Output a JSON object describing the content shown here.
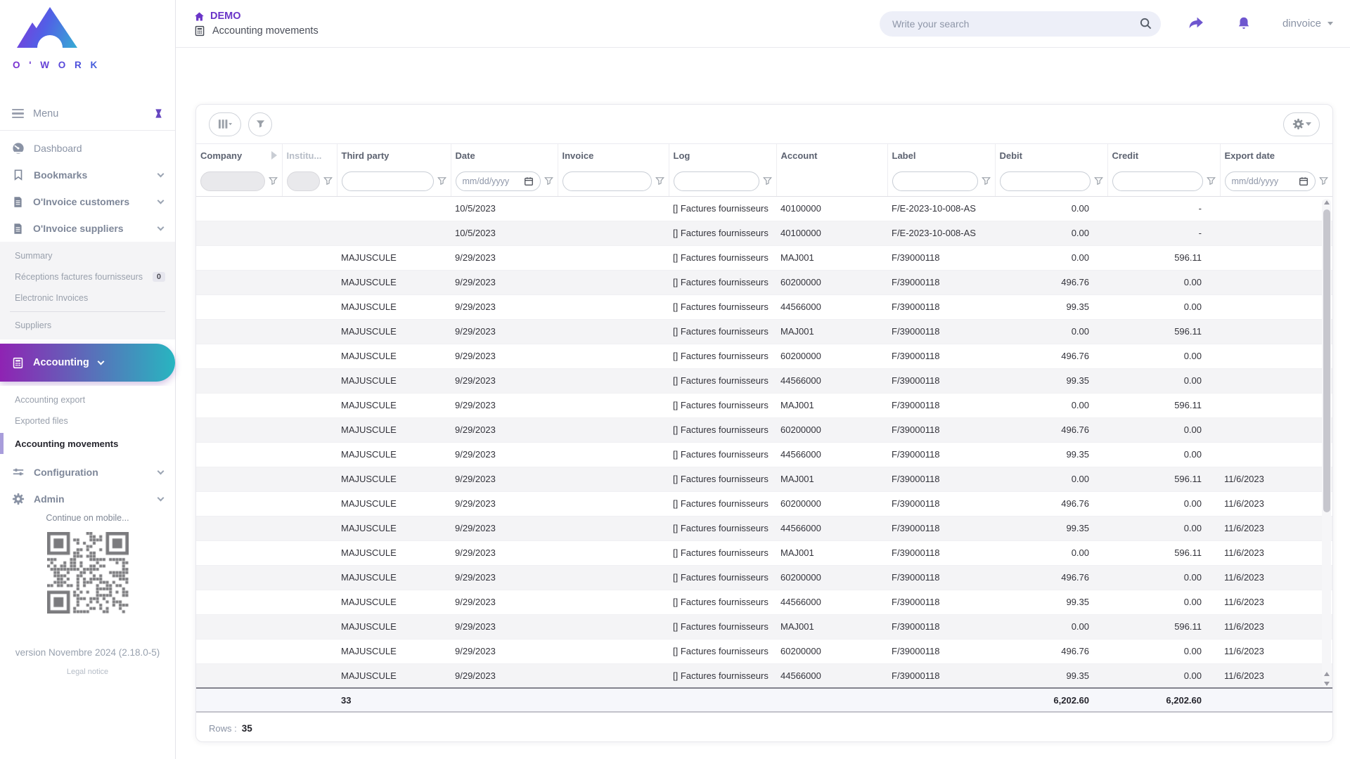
{
  "brand": {
    "wordmark": "O ' W O R K"
  },
  "header": {
    "site_label": "DEMO",
    "breadcrumb": "Accounting movements",
    "search_placeholder": "Write your search",
    "username": "dinvoice"
  },
  "sidebar": {
    "menu_label": "Menu",
    "items": {
      "dashboard": "Dashboard",
      "bookmarks": "Bookmarks",
      "customers": "O'Invoice customers",
      "suppliers_group": "O'Invoice suppliers",
      "accounting": "Accounting",
      "configuration": "Configuration",
      "admin": "Admin"
    },
    "suppliers_submenu": {
      "summary": "Summary",
      "receptions": "Réceptions factures fournisseurs",
      "receptions_badge": "0",
      "electronic_invoices": "Electronic Invoices",
      "suppliers": "Suppliers"
    },
    "accounting_submenu": {
      "export": "Accounting export",
      "exported_files": "Exported files",
      "movements": "Accounting movements"
    },
    "mobile_hint": "Continue on mobile...",
    "version": "version Novembre 2024 (2.18.0-5)",
    "legal_notice": "Legal notice"
  },
  "table": {
    "columns": [
      "Company",
      "Institu...",
      "Third party",
      "Date",
      "Invoice",
      "Log",
      "Account",
      "Label",
      "Debit",
      "Credit",
      "Export date"
    ],
    "date_placeholder": "mm/dd/yyyy",
    "rows": [
      [
        "",
        "",
        "",
        "10/5/2023",
        "",
        "[] Factures fournisseurs",
        "40100000",
        "F/E-2023-10-008-AS",
        "0.00",
        "-",
        ""
      ],
      [
        "",
        "",
        "",
        "10/5/2023",
        "",
        "[] Factures fournisseurs",
        "40100000",
        "F/E-2023-10-008-AS",
        "0.00",
        "-",
        ""
      ],
      [
        "",
        "",
        "MAJUSCULE",
        "9/29/2023",
        "",
        "[] Factures fournisseurs",
        "MAJ001",
        "F/39000118",
        "0.00",
        "596.11",
        ""
      ],
      [
        "",
        "",
        "MAJUSCULE",
        "9/29/2023",
        "",
        "[] Factures fournisseurs",
        "60200000",
        "F/39000118",
        "496.76",
        "0.00",
        ""
      ],
      [
        "",
        "",
        "MAJUSCULE",
        "9/29/2023",
        "",
        "[] Factures fournisseurs",
        "44566000",
        "F/39000118",
        "99.35",
        "0.00",
        ""
      ],
      [
        "",
        "",
        "MAJUSCULE",
        "9/29/2023",
        "",
        "[] Factures fournisseurs",
        "MAJ001",
        "F/39000118",
        "0.00",
        "596.11",
        ""
      ],
      [
        "",
        "",
        "MAJUSCULE",
        "9/29/2023",
        "",
        "[] Factures fournisseurs",
        "60200000",
        "F/39000118",
        "496.76",
        "0.00",
        ""
      ],
      [
        "",
        "",
        "MAJUSCULE",
        "9/29/2023",
        "",
        "[] Factures fournisseurs",
        "44566000",
        "F/39000118",
        "99.35",
        "0.00",
        ""
      ],
      [
        "",
        "",
        "MAJUSCULE",
        "9/29/2023",
        "",
        "[] Factures fournisseurs",
        "MAJ001",
        "F/39000118",
        "0.00",
        "596.11",
        ""
      ],
      [
        "",
        "",
        "MAJUSCULE",
        "9/29/2023",
        "",
        "[] Factures fournisseurs",
        "60200000",
        "F/39000118",
        "496.76",
        "0.00",
        ""
      ],
      [
        "",
        "",
        "MAJUSCULE",
        "9/29/2023",
        "",
        "[] Factures fournisseurs",
        "44566000",
        "F/39000118",
        "99.35",
        "0.00",
        ""
      ],
      [
        "",
        "",
        "MAJUSCULE",
        "9/29/2023",
        "",
        "[] Factures fournisseurs",
        "MAJ001",
        "F/39000118",
        "0.00",
        "596.11",
        "11/6/2023"
      ],
      [
        "",
        "",
        "MAJUSCULE",
        "9/29/2023",
        "",
        "[] Factures fournisseurs",
        "60200000",
        "F/39000118",
        "496.76",
        "0.00",
        "11/6/2023"
      ],
      [
        "",
        "",
        "MAJUSCULE",
        "9/29/2023",
        "",
        "[] Factures fournisseurs",
        "44566000",
        "F/39000118",
        "99.35",
        "0.00",
        "11/6/2023"
      ],
      [
        "",
        "",
        "MAJUSCULE",
        "9/29/2023",
        "",
        "[] Factures fournisseurs",
        "MAJ001",
        "F/39000118",
        "0.00",
        "596.11",
        "11/6/2023"
      ],
      [
        "",
        "",
        "MAJUSCULE",
        "9/29/2023",
        "",
        "[] Factures fournisseurs",
        "60200000",
        "F/39000118",
        "496.76",
        "0.00",
        "11/6/2023"
      ],
      [
        "",
        "",
        "MAJUSCULE",
        "9/29/2023",
        "",
        "[] Factures fournisseurs",
        "44566000",
        "F/39000118",
        "99.35",
        "0.00",
        "11/6/2023"
      ],
      [
        "",
        "",
        "MAJUSCULE",
        "9/29/2023",
        "",
        "[] Factures fournisseurs",
        "MAJ001",
        "F/39000118",
        "0.00",
        "596.11",
        "11/6/2023"
      ],
      [
        "",
        "",
        "MAJUSCULE",
        "9/29/2023",
        "",
        "[] Factures fournisseurs",
        "60200000",
        "F/39000118",
        "496.76",
        "0.00",
        "11/6/2023"
      ],
      [
        "",
        "",
        "MAJUSCULE",
        "9/29/2023",
        "",
        "[] Factures fournisseurs",
        "44566000",
        "F/39000118",
        "99.35",
        "0.00",
        "11/6/2023"
      ]
    ],
    "footer": {
      "third_party_total": "33",
      "debit_total": "6,202.60",
      "credit_total": "6,202.60"
    },
    "rows_label": "Rows :",
    "rows_value": "35"
  }
}
